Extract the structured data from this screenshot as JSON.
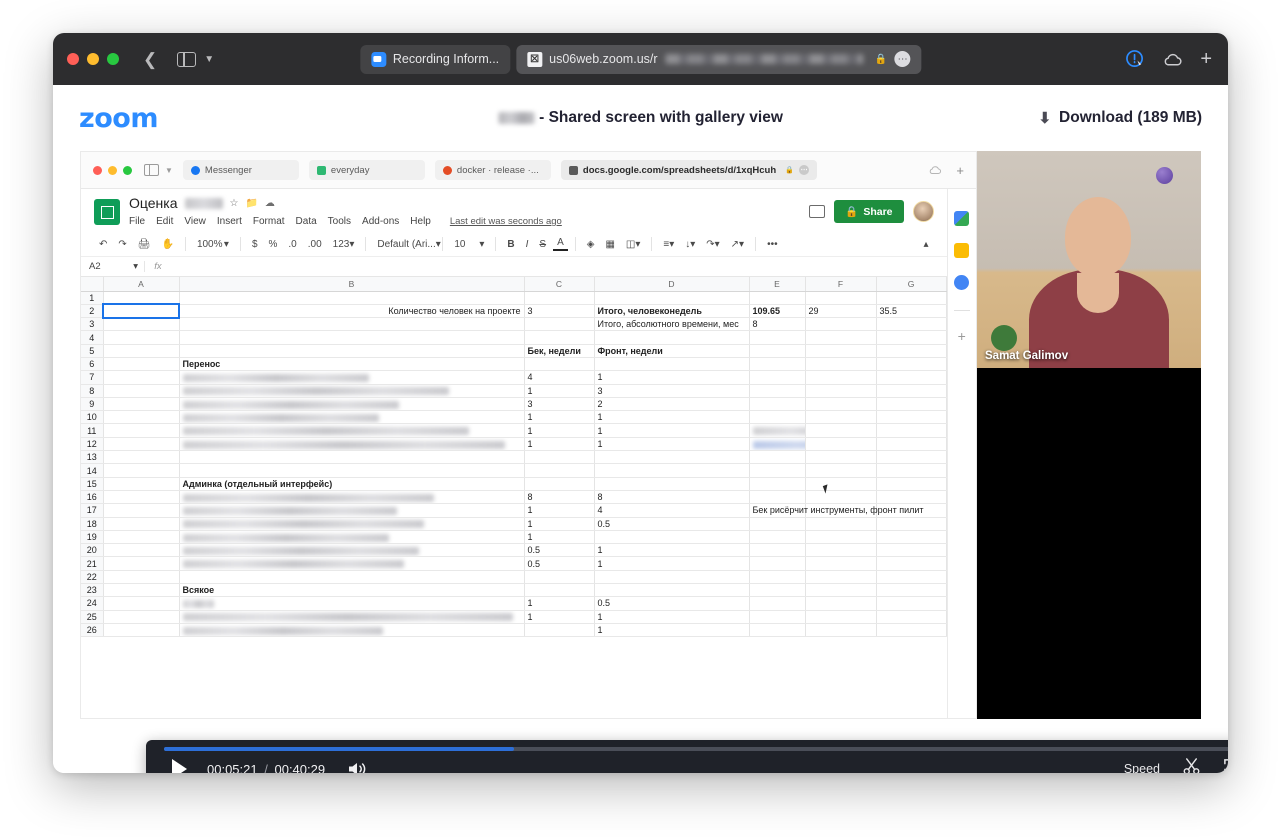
{
  "safari": {
    "back_icon": "back-chevron-icon",
    "sidebar_icon": "sidebar-toggle-icon",
    "tabs": [
      {
        "label": "Recording Inform...",
        "favicon": "zoom-icon",
        "active": false
      },
      {
        "label": "us06web.zoom.us/r",
        "favicon": "close-x-icon",
        "active": true,
        "lock": "🔒",
        "dots": "•••"
      }
    ],
    "toolbar_right": [
      "extension-icon",
      "cloud-icon",
      "new-tab-plus-icon"
    ]
  },
  "zoom_page": {
    "logo": "zoom",
    "title_suffix": "- Shared screen with gallery view",
    "download_label": "Download (189 MB)",
    "download_icon": "download-arrow-icon"
  },
  "inner_browser": {
    "tabs": [
      {
        "label": "Messenger",
        "favicon": "messenger-icon"
      },
      {
        "label": "everyday",
        "favicon": "evernote-icon"
      },
      {
        "label": "docker · release ·...",
        "favicon": "gitlab-icon"
      }
    ],
    "address": "docs.google.com/spreadsheets/d/1xqHcuh",
    "lock_icon": "lock-icon",
    "dots_icon": "more-icon",
    "cloud_icon": "cloud-icon",
    "plus_icon": "plus-icon"
  },
  "sheets": {
    "doc_title": "Оценка",
    "star_icon": "star-icon",
    "move_icon": "move-to-folder-icon",
    "cloud_icon": "drive-cloud-icon",
    "menus": [
      "File",
      "Edit",
      "View",
      "Insert",
      "Format",
      "Data",
      "Tools",
      "Add-ons",
      "Help"
    ],
    "last_edit": "Last edit was seconds ago",
    "comment_icon": "comment-icon",
    "share_label": "Share",
    "share_lock_icon": "share-lock-icon",
    "avatar": "user-avatar",
    "toolbar": {
      "undo": "↶",
      "redo": "↷",
      "print": "print-icon",
      "paint": "paint-format-icon",
      "zoom": "100%",
      "currency": "$",
      "percent": "%",
      "dec_less": ".0",
      "dec_more": ".00",
      "formats": "123",
      "font": "Default (Ari...",
      "size": "10",
      "bold": "B",
      "italic": "I",
      "strike": "S",
      "text_color": "A",
      "fill": "fill-color-icon",
      "borders": "borders-icon",
      "merge": "merge-cells-icon",
      "halign": "horizontal-align-icon",
      "valign": "vertical-align-icon",
      "wrap": "text-wrap-icon",
      "rotate": "text-rotation-icon",
      "more": "•••",
      "collapse": "collapse-toolbar-icon"
    },
    "cell_ref": "A2",
    "fx": "fx",
    "columns": [
      "A",
      "B",
      "C",
      "D",
      "E",
      "F",
      "G"
    ],
    "rows": [
      {
        "n": "1",
        "A": "",
        "B": "",
        "C": "",
        "D": "",
        "E": "",
        "F": "",
        "G": ""
      },
      {
        "n": "2",
        "A": "",
        "B": "Количество человек на проекте",
        "C": "3",
        "D": "Итого, человеконедель",
        "E": "109.65",
        "F": "29",
        "G": "35.5",
        "B_align": "right",
        "D_bold": true,
        "E_bold": true
      },
      {
        "n": "3",
        "A": "",
        "B": "",
        "C": "",
        "D": "Итого, абсолютного времени, мес",
        "E": "8",
        "F": "",
        "G": ""
      },
      {
        "n": "4",
        "A": "",
        "B": "",
        "C": "",
        "D": "",
        "E": "",
        "F": "",
        "G": ""
      },
      {
        "n": "5",
        "A": "",
        "B": "",
        "C": "Бек, недели",
        "D": "Фронт, недели",
        "E": "",
        "F": "",
        "G": "",
        "C_bold": true,
        "D_bold": true
      },
      {
        "n": "6",
        "A": "",
        "B": "Перенос",
        "C": "",
        "D": "",
        "E": "",
        "F": "",
        "G": "",
        "B_bold": true
      },
      {
        "n": "7",
        "A": "",
        "B": "",
        "C": "4",
        "D": "1",
        "E": "",
        "F": "",
        "G": "",
        "B_blur": 186
      },
      {
        "n": "8",
        "A": "",
        "B": "",
        "C": "1",
        "D": "3",
        "E": "",
        "F": "",
        "G": "",
        "B_blur": 266
      },
      {
        "n": "9",
        "A": "",
        "B": "",
        "C": "3",
        "D": "2",
        "E": "",
        "F": "",
        "G": "",
        "B_blur": 216
      },
      {
        "n": "10",
        "A": "",
        "B": "",
        "C": "1",
        "D": "1",
        "E": "",
        "F": "",
        "G": "",
        "B_blur": 196
      },
      {
        "n": "11",
        "A": "",
        "B": "",
        "C": "1",
        "D": "1",
        "E": "",
        "F": "",
        "G": "",
        "B_blur": 286,
        "E_blur": 152
      },
      {
        "n": "12",
        "A": "",
        "B": "",
        "C": "1",
        "D": "1",
        "E": "",
        "F": "",
        "G": "",
        "B_blur": 322,
        "E_blur_blue": 88
      },
      {
        "n": "13",
        "A": "",
        "B": "",
        "C": "",
        "D": "",
        "E": "",
        "F": "",
        "G": ""
      },
      {
        "n": "14",
        "A": "",
        "B": "",
        "C": "",
        "D": "",
        "E": "",
        "F": "",
        "G": ""
      },
      {
        "n": "15",
        "A": "",
        "B": "Админка (отдельный интерфейс)",
        "C": "",
        "D": "",
        "E": "",
        "F": "",
        "G": "",
        "B_bold": true
      },
      {
        "n": "16",
        "A": "",
        "B": "",
        "C": "8",
        "D": "8",
        "E": "",
        "F": "",
        "G": "",
        "B_blur": 251
      },
      {
        "n": "17",
        "A": "",
        "B": "",
        "C": "1",
        "D": "4",
        "E": "Бек рисёрчит инструменты, фронт пилит",
        "F": "",
        "G": "",
        "B_blur": 214,
        "E_wide": true
      },
      {
        "n": "18",
        "A": "",
        "B": "",
        "C": "1",
        "D": "0.5",
        "E": "",
        "F": "",
        "G": "",
        "B_blur": 241
      },
      {
        "n": "19",
        "A": "",
        "B": "",
        "C": "1",
        "D": "",
        "E": "",
        "F": "",
        "G": "",
        "B_blur": 206
      },
      {
        "n": "20",
        "A": "",
        "B": "",
        "C": "0.5",
        "D": "1",
        "E": "",
        "F": "",
        "G": "",
        "B_blur": 236
      },
      {
        "n": "21",
        "A": "",
        "B": "",
        "C": "0.5",
        "D": "1",
        "E": "",
        "F": "",
        "G": "",
        "B_blur": 221
      },
      {
        "n": "22",
        "A": "",
        "B": "",
        "C": "",
        "D": "",
        "E": "",
        "F": "",
        "G": ""
      },
      {
        "n": "23",
        "A": "",
        "B": "Всякое",
        "C": "",
        "D": "",
        "E": "",
        "F": "",
        "G": "",
        "B_bold": true
      },
      {
        "n": "24",
        "A": "",
        "B": "",
        "C": "1",
        "D": "0.5",
        "E": "",
        "F": "",
        "G": "",
        "B_blur": 31
      },
      {
        "n": "25",
        "A": "",
        "B": "",
        "C": "1",
        "D": "1",
        "E": "",
        "F": "",
        "G": "",
        "B_blur": 330
      },
      {
        "n": "26",
        "A": "",
        "B": "",
        "C": "",
        "D": "1",
        "E": "",
        "F": "",
        "G": "",
        "B_blur": 200
      }
    ],
    "side_rail": [
      "google-calendar-icon",
      "google-keep-icon",
      "google-tasks-icon",
      "add-addon-plus-icon"
    ]
  },
  "webcam": {
    "participant_name": "Samat Galimov"
  },
  "player": {
    "play_icon": "play-icon",
    "current_time": "00:05:21",
    "separator": "/",
    "total_time": "00:40:29",
    "volume_icon": "volume-icon",
    "speed_label": "Speed",
    "trim_icon": "scissors-icon",
    "fullscreen_icon": "fullscreen-icon",
    "progress_percent": 32.5
  },
  "colors": {
    "zoom_blue": "#2d8cff",
    "sheets_green": "#0f9d58",
    "share_green": "#1e8e3e",
    "progress_blue": "#2d6fd8",
    "selection_blue": "#1a73e8"
  }
}
